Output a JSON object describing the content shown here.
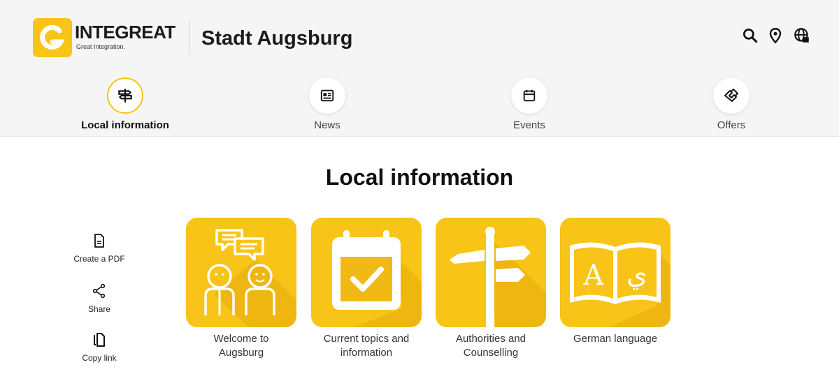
{
  "header": {
    "brand": "INTEGREAT",
    "tagline": "Great Integration.",
    "city": "Stadt Augsburg",
    "icons": [
      "search-icon",
      "location-pin-icon",
      "language-icon"
    ]
  },
  "nav": {
    "tabs": [
      {
        "label": "Local information",
        "icon": "signpost-icon",
        "active": true
      },
      {
        "label": "News",
        "icon": "newspaper-icon",
        "active": false
      },
      {
        "label": "Events",
        "icon": "calendar-icon",
        "active": false
      },
      {
        "label": "Offers",
        "icon": "handshake-icon",
        "active": false
      }
    ]
  },
  "main": {
    "title": "Local information",
    "tools": [
      {
        "label": "Create a PDF",
        "icon": "pdf-file-icon"
      },
      {
        "label": "Share",
        "icon": "share-icon"
      },
      {
        "label": "Copy link",
        "icon": "copy-icon"
      }
    ],
    "categories": [
      {
        "label_line1": "Welcome to",
        "label_line2": "Augsburg",
        "icon": "welcome-people-icon"
      },
      {
        "label_line1": "Current topics and",
        "label_line2": "information",
        "icon": "calendar-check-icon"
      },
      {
        "label_line1": "Authorities and",
        "label_line2": "Counselling",
        "icon": "signpost-icon"
      },
      {
        "label_line1": "German language",
        "label_line2": "",
        "icon": "book-icon"
      }
    ]
  },
  "colors": {
    "accent": "#f9c418",
    "background": "#f5f5f5"
  }
}
